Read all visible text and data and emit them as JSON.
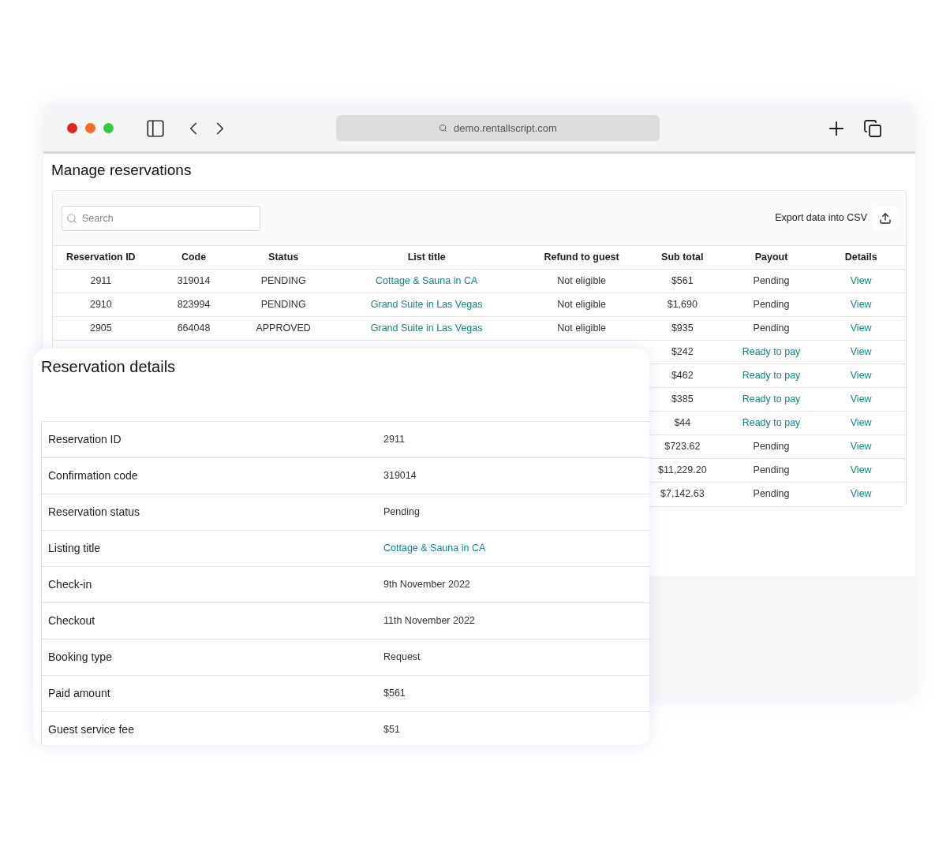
{
  "browser": {
    "url": "demo.rentallscript.com"
  },
  "page": {
    "title": "Manage reservations"
  },
  "search": {
    "placeholder": "Search"
  },
  "export": {
    "label": "Export data into CSV"
  },
  "table": {
    "columns": [
      "Reservation ID",
      "Code",
      "Status",
      "List title",
      "Refund to guest",
      "Sub total",
      "Payout",
      "Details"
    ],
    "rows": [
      {
        "id": "2911",
        "code": "319014",
        "status": "PENDING",
        "title": "Cottage & Sauna in CA",
        "refund": "Not eligible",
        "subtotal": "$561",
        "payout": {
          "text": "Pending",
          "ready": false
        },
        "details": "View"
      },
      {
        "id": "2910",
        "code": "823994",
        "status": "PENDING",
        "title": "Grand Suite in Las Vegas",
        "refund": "Not eligible",
        "subtotal": "$1,690",
        "payout": {
          "text": "Pending",
          "ready": false
        },
        "details": "View"
      },
      {
        "id": "2905",
        "code": "664048",
        "status": "APPROVED",
        "title": "Grand Suite in Las Vegas",
        "refund": "Not eligible",
        "subtotal": "$935",
        "payout": {
          "text": "Pending",
          "ready": false
        },
        "details": "View"
      },
      {
        "subtotal": "$242",
        "payout": {
          "text": "Ready to pay",
          "ready": true
        },
        "details": "View"
      },
      {
        "subtotal": "$462",
        "payout": {
          "text": "Ready to pay",
          "ready": true
        },
        "details": "View"
      },
      {
        "subtotal": "$385",
        "payout": {
          "text": "Ready to pay",
          "ready": true
        },
        "details": "View"
      },
      {
        "subtotal": "$44",
        "payout": {
          "text": "Ready to pay",
          "ready": true
        },
        "details": "View"
      },
      {
        "subtotal": "$723.62",
        "payout": {
          "text": "Pending",
          "ready": false
        },
        "details": "View"
      },
      {
        "subtotal": "$11,229.20",
        "payout": {
          "text": "Pending",
          "ready": false
        },
        "details": "View"
      },
      {
        "subtotal": "$7,142.63",
        "payout": {
          "text": "Pending",
          "ready": false
        },
        "details": "View"
      }
    ]
  },
  "details": {
    "title": "Reservation details",
    "rows": [
      {
        "label": "Reservation ID",
        "value": "2911",
        "kind": "text"
      },
      {
        "label": "Confirmation code",
        "value": "319014",
        "kind": "text"
      },
      {
        "label": "Reservation status",
        "value": "Pending",
        "kind": "text"
      },
      {
        "label": "Listing title",
        "value": "Cottage & Sauna in CA",
        "kind": "link"
      },
      {
        "label": "Check-in",
        "value": "9th November 2022",
        "kind": "text"
      },
      {
        "label": "Checkout",
        "value": "11th November 2022",
        "kind": "text"
      },
      {
        "label": "Booking type",
        "value": "Request",
        "kind": "text"
      },
      {
        "label": "Paid amount",
        "value": "$561",
        "kind": "text"
      },
      {
        "label": "Guest service fee",
        "value": "$51",
        "kind": "text"
      }
    ]
  }
}
